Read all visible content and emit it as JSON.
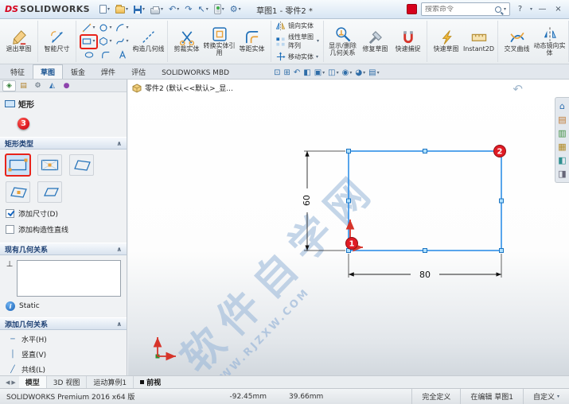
{
  "window": {
    "logo_mark": "DS",
    "logo_text": "SOLIDWORKS",
    "title": "草图1 - 零件2 *",
    "search_placeholder": "搜索命令",
    "help": "?",
    "minimize": "—",
    "close": "×"
  },
  "glyphs": {
    "caret": "▾",
    "chevron": "∧",
    "undo": "↶",
    "redo": "↷",
    "select": "↖",
    "settings": "⚙",
    "collapse": "↶",
    "perpendicular": "⊥",
    "info": "i",
    "scroll_left": "◀",
    "scroll_right": "▶"
  },
  "headsup": [
    "⊡",
    "⊞",
    "↶",
    "◧",
    "▣",
    "◫",
    "◉",
    "◕",
    "▤"
  ],
  "ribbon": {
    "exit_sketch": "退出草图",
    "smart_dimension": "智能尺寸",
    "construction_geometry": "构造几何线",
    "trim": "剪裁实体",
    "convert": "转换实体引用",
    "offset": "等距实体",
    "mirror": "镜向实体",
    "linear_pattern": "线性草图阵列",
    "move": "移动实体",
    "display_delete_relations": "显示/删除几何关系",
    "repair_sketch": "修复草图",
    "quick_snaps": "快速捕捉",
    "rapid_sketch": "快速草图",
    "instant2d": "Instant2D",
    "intersection_curve": "交叉曲线",
    "dynamic_mirror": "动态镜向实体"
  },
  "tabs": [
    "特征",
    "草图",
    "钣金",
    "焊件",
    "评估",
    "SOLIDWORKS MBD"
  ],
  "tree_part": "零件2 (默认<<默认>_显...",
  "panel": {
    "title": "矩形",
    "rect_type_header": "矩形类型",
    "add_dimensions": "添加尺寸(D)",
    "add_construction": "添加构造性直线",
    "existing_header": "现有几何关系",
    "static_label": "Static",
    "add_header": "添加几何关系",
    "relations": [
      {
        "icon": "─",
        "label": "水平(H)"
      },
      {
        "icon": "│",
        "label": "竖直(V)"
      },
      {
        "icon": "╱",
        "label": "共线(L)"
      }
    ]
  },
  "panel_tabs": [
    "◈",
    "▤",
    "⚙",
    "◭",
    "●"
  ],
  "task_icons": [
    "⌂",
    "▤",
    "▥",
    "▦",
    "◧",
    "◨"
  ],
  "badges": {
    "one": "1",
    "two": "2",
    "three": "3"
  },
  "sketch": {
    "width": "80",
    "height": "60"
  },
  "watermark": {
    "line1": "软件自学网",
    "line2": "WWW.RJZXW.COM"
  },
  "view_label": "前视",
  "bottom_tabs": [
    "模型",
    "3D 视图",
    "运动算例1"
  ],
  "statusbar": {
    "product": "SOLIDWORKS Premium 2016 x64 版",
    "x": "-92.45mm",
    "y": "39.66mm",
    "state": "完全定义",
    "editing": "在编辑 草图1",
    "custom": "自定义"
  }
}
